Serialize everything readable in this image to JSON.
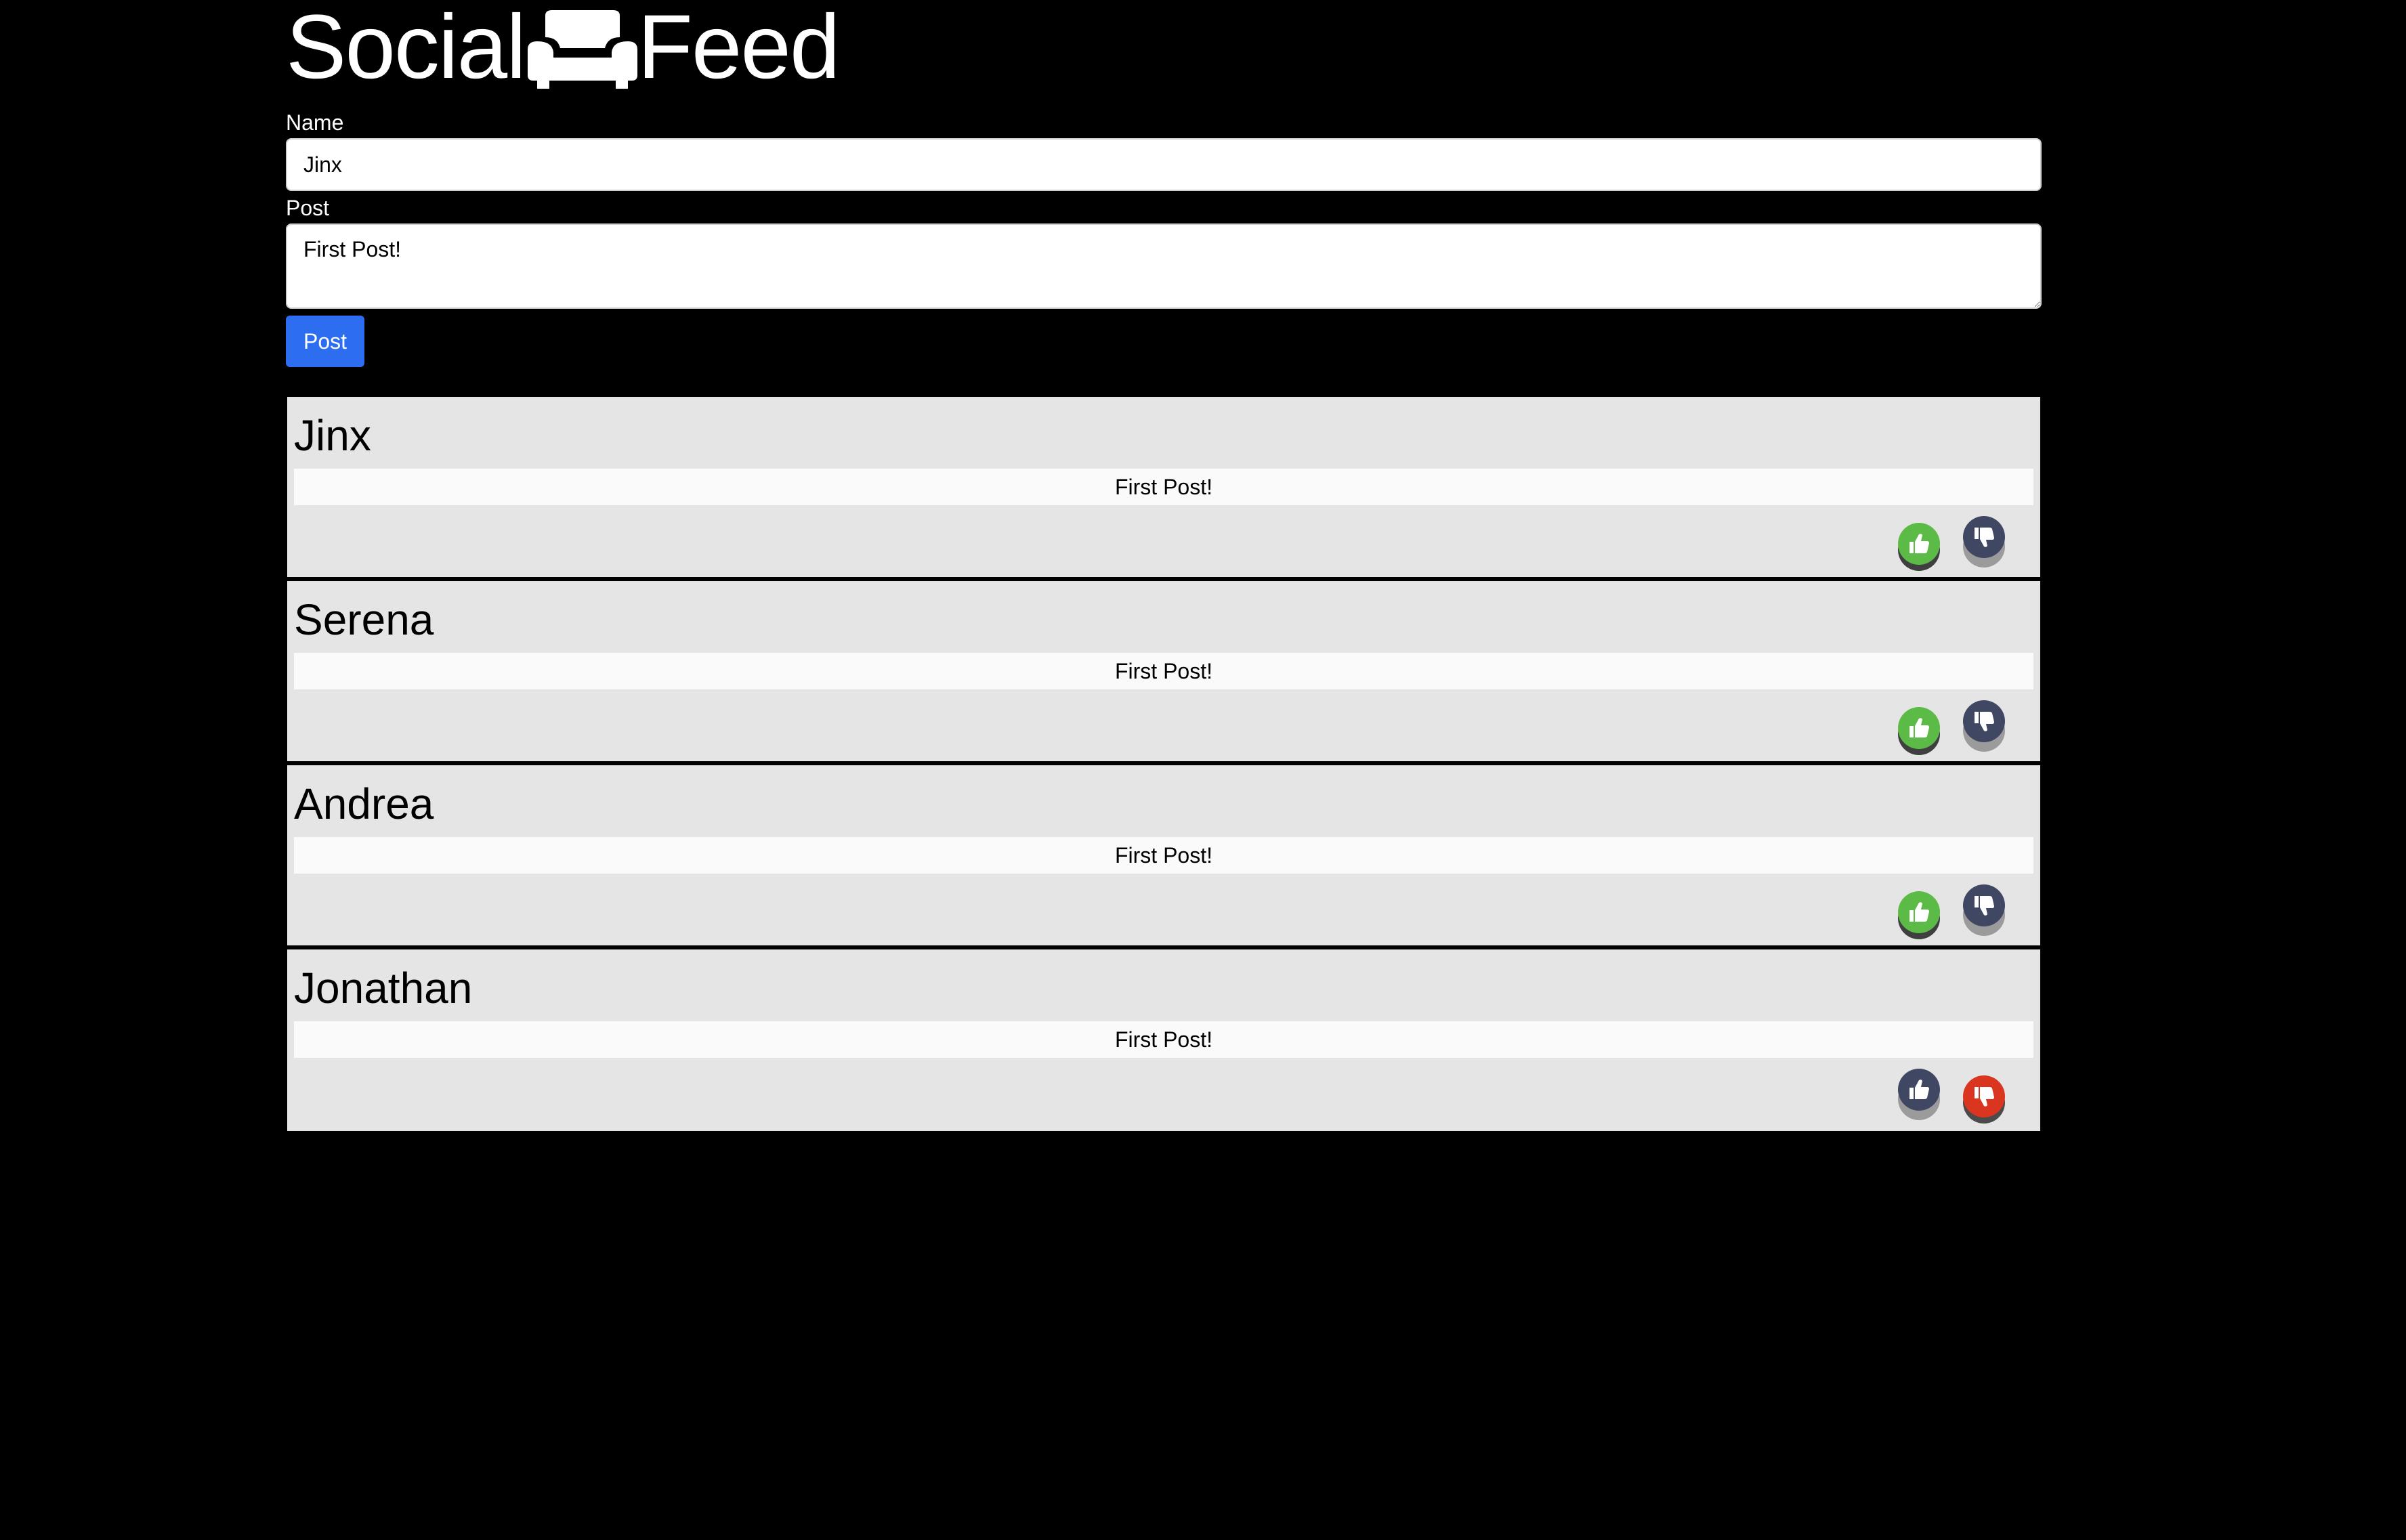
{
  "app": {
    "title_left": "Social",
    "title_right": "Feed",
    "logo_icon": "couch-icon"
  },
  "form": {
    "name_label": "Name",
    "name_value": "Jinx",
    "post_label": "Post",
    "post_value": "First Post!",
    "submit_label": "Post"
  },
  "colors": {
    "background": "#000000",
    "accent_blue": "#2d6ef0",
    "like_green": "#5cbb46",
    "dislike_red": "#d9351f",
    "inactive_navy": "#3f4762",
    "card_grey": "#e6e5e6"
  },
  "feed": [
    {
      "author": "Jinx",
      "body": "First Post!",
      "like_icon": "thumbs-up-icon",
      "dislike_icon": "thumbs-down-icon",
      "vote": "like"
    },
    {
      "author": "Serena",
      "body": "First Post!",
      "like_icon": "thumbs-up-icon",
      "dislike_icon": "thumbs-down-icon",
      "vote": "like"
    },
    {
      "author": "Andrea",
      "body": "First Post!",
      "like_icon": "thumbs-up-icon",
      "dislike_icon": "thumbs-down-icon",
      "vote": "like"
    },
    {
      "author": "Jonathan",
      "body": "First Post!",
      "like_icon": "thumbs-up-icon",
      "dislike_icon": "thumbs-down-icon",
      "vote": "dislike"
    }
  ]
}
